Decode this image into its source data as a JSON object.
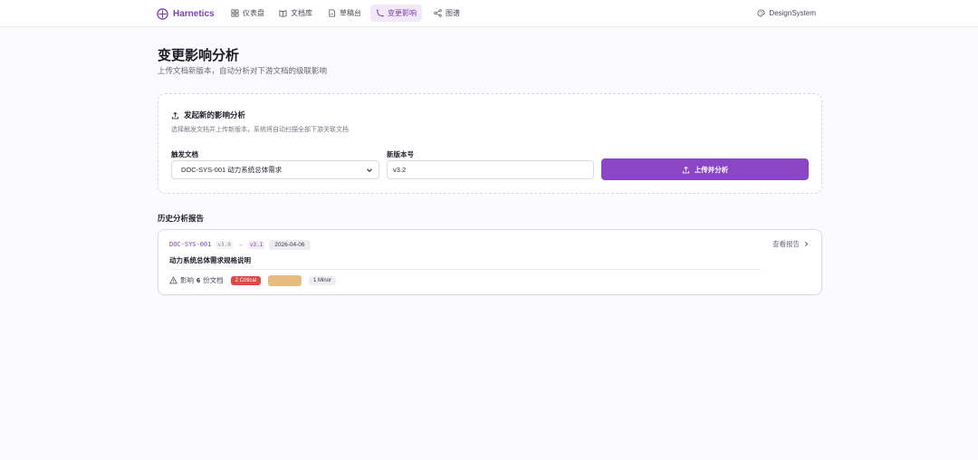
{
  "nav": {
    "brand": "Harnetics",
    "items": [
      {
        "label": "仪表盘",
        "icon": "dashboard-icon"
      },
      {
        "label": "文档库",
        "icon": "book-icon"
      },
      {
        "label": "草稿台",
        "icon": "draft-icon"
      },
      {
        "label": "变更影响",
        "icon": "impact-icon",
        "active": true
      },
      {
        "label": "图谱",
        "icon": "graph-icon"
      }
    ],
    "design_system": "DesignSystem"
  },
  "header": {
    "title": "变更影响分析",
    "subtitle": "上传文档新版本，自动分析对下游文档的级联影响"
  },
  "upload_card": {
    "title": "发起新的影响分析",
    "description": "选择触发文档并上传新版本，系统将自动扫描全部下游关联文档",
    "trigger_label": "触发文档",
    "trigger_value": "DOC-SYS-001 动力系统总体需求",
    "version_label": "新版本号",
    "version_value": "v3.2",
    "upload_button": "上传并分析"
  },
  "history": {
    "section_title": "历史分析报告",
    "reports": [
      {
        "doc_id": "DOC-SYS-001",
        "from_version": "v3.0",
        "arrow": "→",
        "to_version": "v3.1",
        "date": "2026-04-06",
        "doc_name": "动力系统总体需求规格说明",
        "impact_prefix": "影响",
        "impact_count": "6",
        "impact_suffix": "份文档",
        "critical": "2 Critical",
        "major": "",
        "minor": "1 Minor",
        "view_label": "查看报告"
      }
    ]
  },
  "colors": {
    "accent": "#8b46c6",
    "critical": "#e04848",
    "major": "#e6bc7f"
  }
}
